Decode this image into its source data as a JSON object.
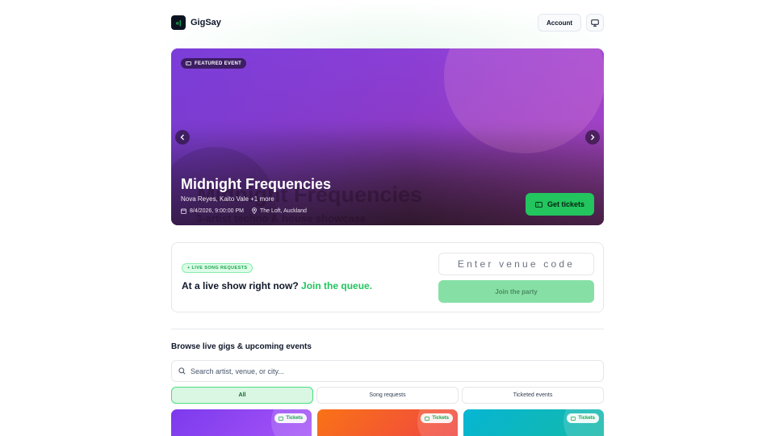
{
  "app": {
    "name": "GigSay",
    "logo_glyph": "«|"
  },
  "header": {
    "account_label": "Account",
    "display_icon": "monitor-icon"
  },
  "hero": {
    "badge": "FEATURED EVENT",
    "title": "Midnight Frequencies",
    "artists": "Nova Reyes, Kaito Vale +1 more",
    "ghost_title": "Midnight Frequencies",
    "ghost_subtitle": "3-artist techno & house showcase",
    "datetime": "8/4/2026, 9:00:00 PM",
    "venue": "The Loft, Auckland",
    "cta_label": "Get tickets",
    "prev_icon": "chevron-left-icon",
    "next_icon": "chevron-right-icon",
    "colors": {
      "gradient_start": "#8b3fd6",
      "gradient_end": "#3a1f36"
    }
  },
  "requests": {
    "badge": "+ LIVE SONG REQUESTS",
    "headline_prefix": "At a live show right now?",
    "headline_accent": "Join the queue.",
    "venue_code_placeholder": "Enter venue code",
    "join_label": "Join the party"
  },
  "browse": {
    "title": "Browse live gigs & upcoming events",
    "search_placeholder": "Search artist, venue, or city...",
    "filters": [
      {
        "label": "All",
        "active": true
      },
      {
        "label": "Song requests",
        "active": false
      },
      {
        "label": "Ticketed events",
        "active": false
      }
    ],
    "cards": [
      {
        "badge": "Tickets"
      },
      {
        "badge": "Tickets"
      },
      {
        "badge": "Tickets"
      }
    ]
  },
  "theme": {
    "accent": "#22c55e",
    "text": "#0f172a",
    "border": "#e5e7eb"
  }
}
